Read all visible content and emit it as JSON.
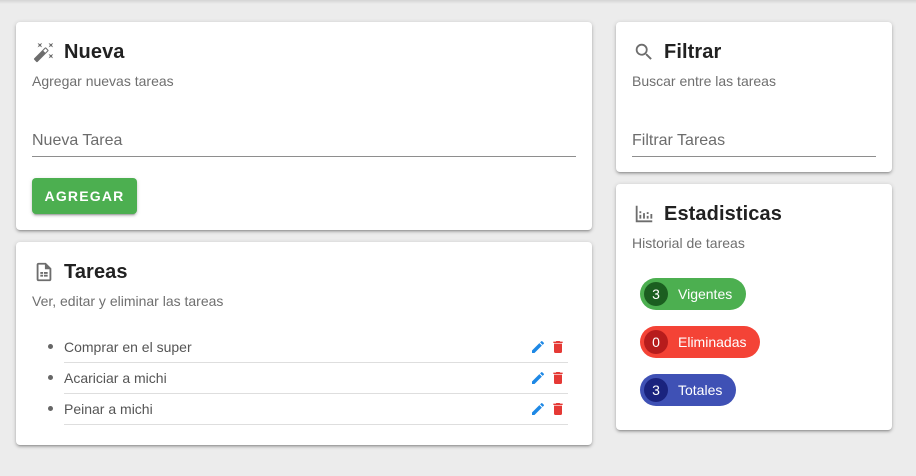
{
  "nueva": {
    "title": "Nueva",
    "subtitle": "Agregar nuevas tareas",
    "input_placeholder": "Nueva Tarea",
    "button_label": "AGREGAR",
    "icon": "magic-wand-icon"
  },
  "tareas": {
    "title": "Tareas",
    "subtitle": "Ver, editar y eliminar las tareas",
    "icon": "document-icon",
    "items": [
      {
        "label": "Comprar en el super"
      },
      {
        "label": "Acariciar a michi"
      },
      {
        "label": "Peinar a michi"
      }
    ]
  },
  "filtrar": {
    "title": "Filtrar",
    "subtitle": "Buscar entre las tareas",
    "input_placeholder": "Filtrar Tareas",
    "icon": "search-icon"
  },
  "estadisticas": {
    "title": "Estadisticas",
    "subtitle": "Historial de tareas",
    "icon": "bar-chart-icon",
    "chips": [
      {
        "count": "3",
        "label": "Vigentes",
        "color": "#4caf50",
        "count_color": "#1b5e20"
      },
      {
        "count": "0",
        "label": "Eliminadas",
        "color": "#f44336",
        "count_color": "#b71c1c"
      },
      {
        "count": "3",
        "label": "Totales",
        "color": "#3f51b5",
        "count_color": "#1a237e"
      }
    ]
  },
  "colors": {
    "edit_icon": "#1e88e5",
    "delete_icon": "#e53935",
    "primary_button": "#4caf50"
  }
}
